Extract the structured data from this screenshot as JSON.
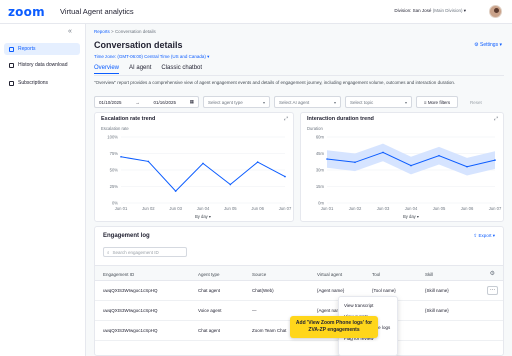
{
  "header": {
    "logo": "zoom",
    "app_title": "Virtual Agent analytics",
    "division_label": "Division: San José",
    "division_sub": "(Main Division)",
    "division_chevron": "chevron-down-icon"
  },
  "sidebar": {
    "collapse": "«",
    "items": [
      {
        "label": "Reports",
        "icon": "reports-icon",
        "active": true
      },
      {
        "label": "History data download",
        "icon": "download-icon",
        "active": false
      },
      {
        "label": "Subscriptions",
        "icon": "bell-icon",
        "active": false
      }
    ]
  },
  "page": {
    "breadcrumb_link": "Reports",
    "breadcrumb_sep": ">",
    "breadcrumb_current": "Conversation details",
    "title": "Conversation details",
    "timezone": "Time zone: (GMT-06:00) Central Time (US and Canada)",
    "settings": "Settings",
    "tabs": [
      "Overview",
      "AI agent",
      "Classic chatbot"
    ],
    "description": "\"Overview\" report provides a comprehensive view of agent engagement events and details of engagement journey, including engagement volume, outcomes and interaction duration."
  },
  "filters": {
    "date_from": "01/10/2025",
    "date_arrow": "→",
    "date_to": "01/16/2025",
    "agent_type": "Select agent type",
    "ai_agent": "Select AI agent",
    "topic": "Select topic",
    "more": "More filters",
    "reset": "Reset"
  },
  "charts": {
    "escalation": {
      "title": "Escalation rate trend",
      "by": "By day"
    },
    "duration": {
      "title": "Interaction duration trend",
      "by": "By day"
    }
  },
  "chart_data": [
    {
      "type": "line",
      "title": "Escalation rate trend",
      "ylabel": "Escalation rate",
      "xlabel": "By day",
      "categories": [
        "Jun 01",
        "Jun 02",
        "Jun 03",
        "Jun 04",
        "Jun 05",
        "Jun 06",
        "Jun 07"
      ],
      "y_ticks": [
        "0%",
        "25%",
        "50%",
        "75%",
        "100%"
      ],
      "ylim": [
        0,
        100
      ],
      "values": [
        70,
        63,
        18,
        60,
        28,
        62,
        40
      ],
      "color": "#0b5cff"
    },
    {
      "type": "area",
      "title": "Interaction duration trend",
      "ylabel": "Duration",
      "xlabel": "By day",
      "categories": [
        "Jun 01",
        "Jun 02",
        "Jun 03",
        "Jun 04",
        "Jun 05",
        "Jun 06",
        "Jun 07"
      ],
      "y_ticks": [
        "0m",
        "15m",
        "30m",
        "45m",
        "60m"
      ],
      "ylim": [
        0,
        60
      ],
      "values": [
        40,
        37,
        46,
        34,
        43,
        33,
        39
      ],
      "band_low": [
        32,
        29,
        38,
        26,
        35,
        25,
        31
      ],
      "band_high": [
        48,
        45,
        54,
        42,
        51,
        41,
        47
      ],
      "color": "#0b5cff",
      "band_color": "#d6e4ff"
    }
  ],
  "log": {
    "title": "Engagement log",
    "export": "Export",
    "search_placeholder": "Search engagement ID",
    "columns": [
      "Engagement ID",
      "Agent type",
      "Source",
      "Virtual agent",
      "Tool",
      "Skill"
    ],
    "rows": [
      [
        "uwqQXtS3WIwgoc1cSpHQ",
        "Chat agent",
        "Chat(Web)",
        "{Agent name}",
        "{Tool name}",
        "{Skill name}"
      ],
      [
        "uwqQXtS3WIwgoc1cSpHQ",
        "Voice agent",
        "—",
        "{Agent name}",
        "{Tool name}",
        "{Skill name}"
      ],
      [
        "uwqQXtS3WIwgoc1cSpHQ",
        "Chat agent",
        "Zoom Team Chat",
        "",
        "",
        ""
      ]
    ],
    "menu": [
      "View transcript",
      "View events",
      "View Zoom Phone logs",
      "Flag for review"
    ],
    "callout_line1": "Add 'View Zoom Phone logs' for",
    "callout_line2": "ZVA-ZP engagements"
  }
}
